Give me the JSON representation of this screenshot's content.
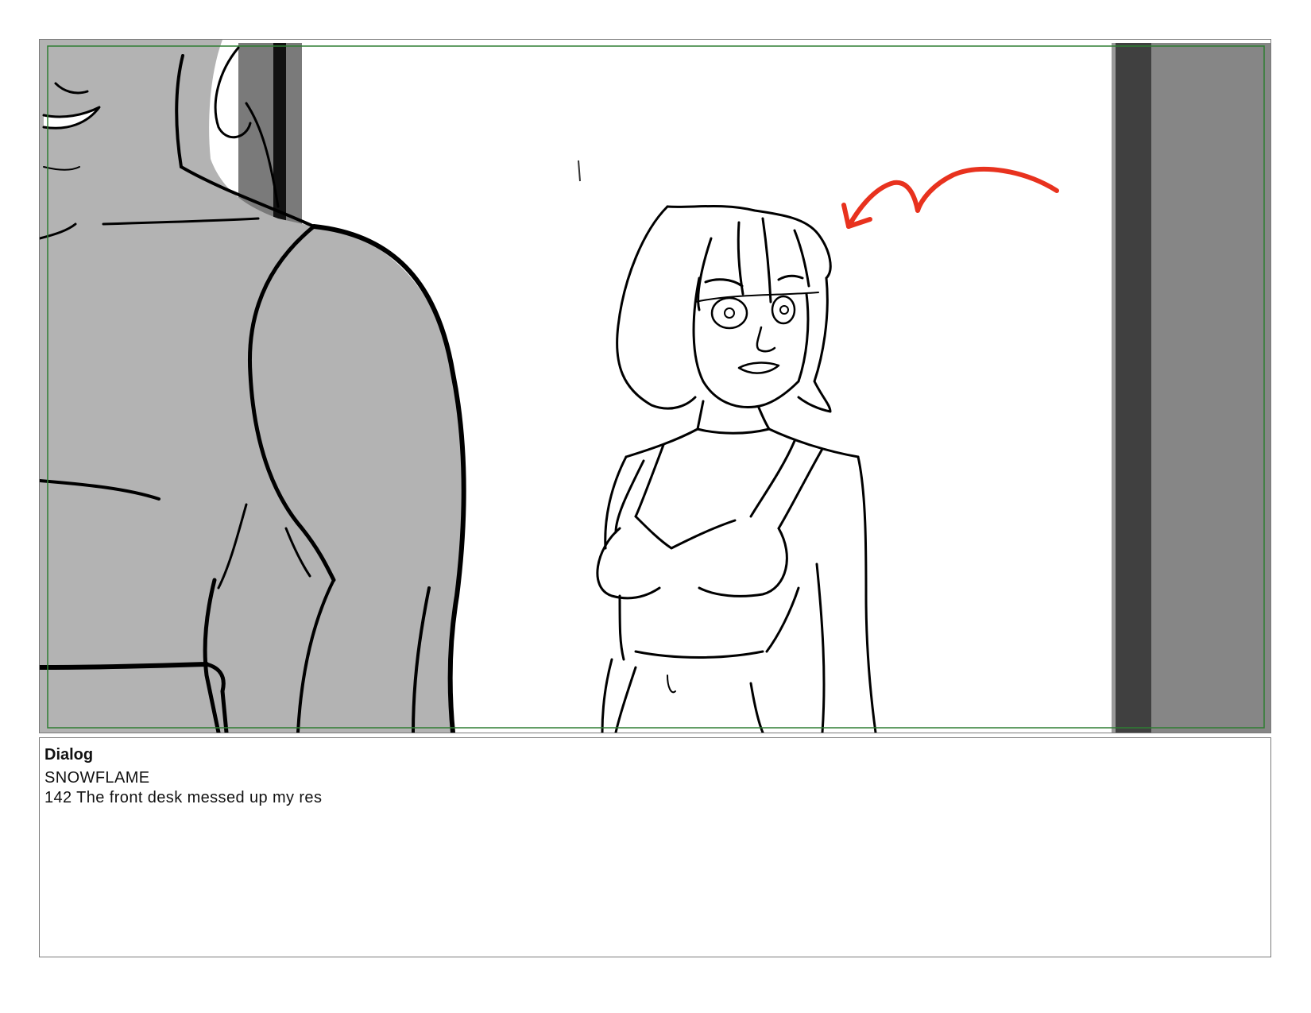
{
  "panel": {
    "safe_frame_color": "#2e7d32",
    "annotation_arrow_color": "#e8321e",
    "figure_fill_color": "#b3b3b3",
    "door_colors": [
      "#404040",
      "#868686"
    ]
  },
  "dialog": {
    "heading": "Dialog",
    "character": "SNOWFLAME",
    "line": "142 The front desk messed up my res"
  }
}
